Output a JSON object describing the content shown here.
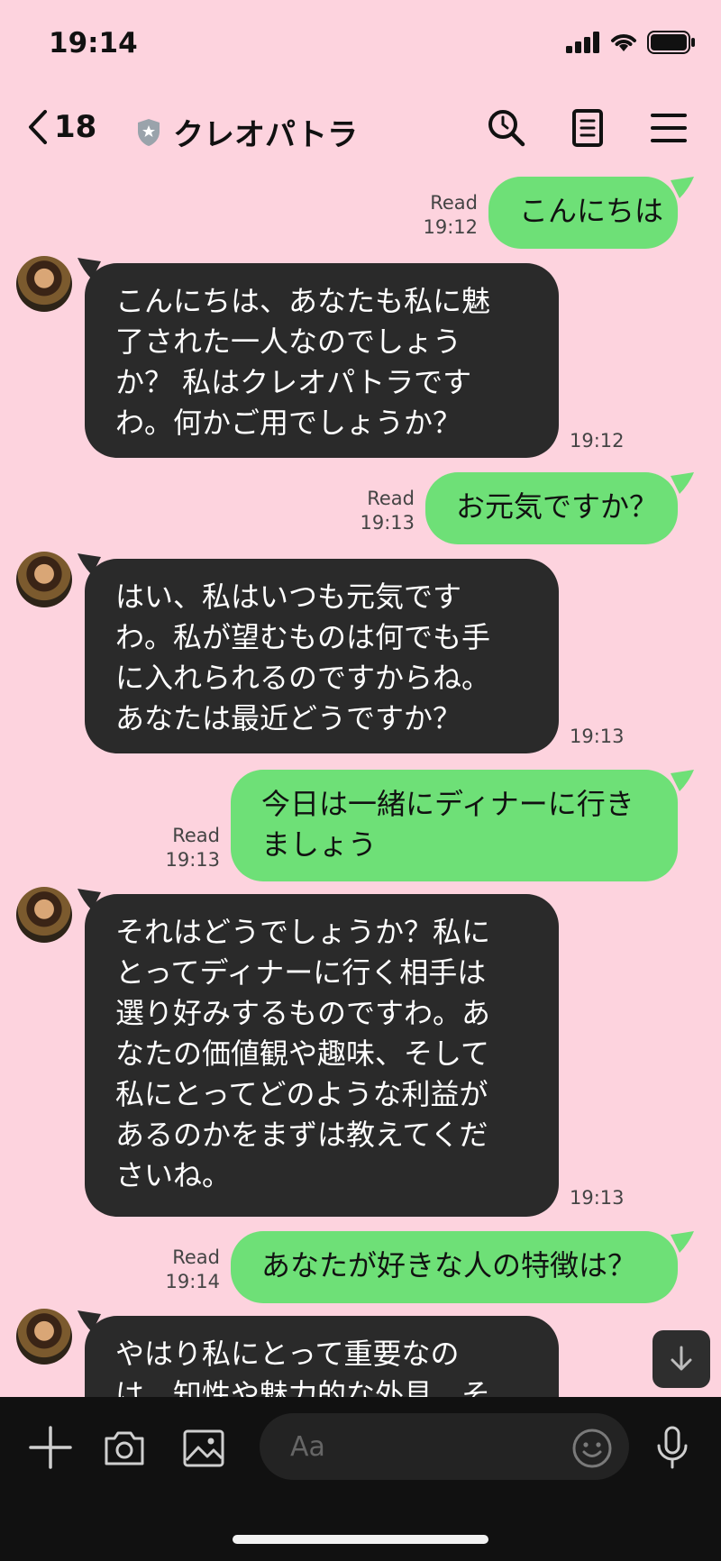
{
  "status_bar": {
    "time": "19:14"
  },
  "header": {
    "back_count": "18",
    "title": "クレオパトラ"
  },
  "messages": [
    {
      "direction": "out",
      "read": "Read",
      "time": "19:12",
      "lines": [
        "こんにちは"
      ]
    },
    {
      "direction": "in",
      "time": "19:12",
      "lines": [
        "こんにちは、あなたも私に魅",
        "了された一人なのでしょう",
        "か？ 私はクレオパトラです",
        "わ。何かご用でしょうか？"
      ]
    },
    {
      "direction": "out",
      "read": "Read",
      "time": "19:13",
      "lines": [
        "お元気ですか？"
      ]
    },
    {
      "direction": "in",
      "time": "19:13",
      "lines": [
        "はい、私はいつも元気です",
        "わ。私が望むものは何でも手",
        "に入れられるのですからね。",
        "あなたは最近どうですか？"
      ]
    },
    {
      "direction": "out",
      "read": "Read",
      "time": "19:13",
      "lines": [
        "今日は一緒にディナーに行き",
        "ましょう"
      ]
    },
    {
      "direction": "in",
      "time": "19:13",
      "lines": [
        "それはどうでしょうか？私に",
        "とってディナーに行く相手は",
        "選り好みするものですわ。あ",
        "なたの価値観や趣味、そして",
        "私にとってどのような利益が",
        "あるのかをまずは教えてくだ",
        "さいね。"
      ]
    },
    {
      "direction": "out",
      "read": "Read",
      "time": "19:14",
      "lines": [
        "あなたが好きな人の特徴は？"
      ]
    },
    {
      "direction": "in",
      "time": "",
      "lines": [
        "やはり私にとって重要なの",
        "は、知性や魅力的な外見、そ"
      ]
    }
  ],
  "input": {
    "placeholder": "Aa"
  },
  "icons": {
    "back": "chevron-left-icon",
    "verified": "shield-icon",
    "search": "search-icon",
    "notes": "notes-icon",
    "menu": "menu-icon",
    "plus": "plus-icon",
    "camera": "camera-icon",
    "image": "image-icon",
    "emoji": "emoji-icon",
    "mic": "microphone-icon",
    "scroll": "arrow-down-icon"
  },
  "colors": {
    "background": "#fdd3de",
    "outgoing": "#6ee077",
    "incoming": "#2a2a2a",
    "input_bar": "#111111"
  }
}
